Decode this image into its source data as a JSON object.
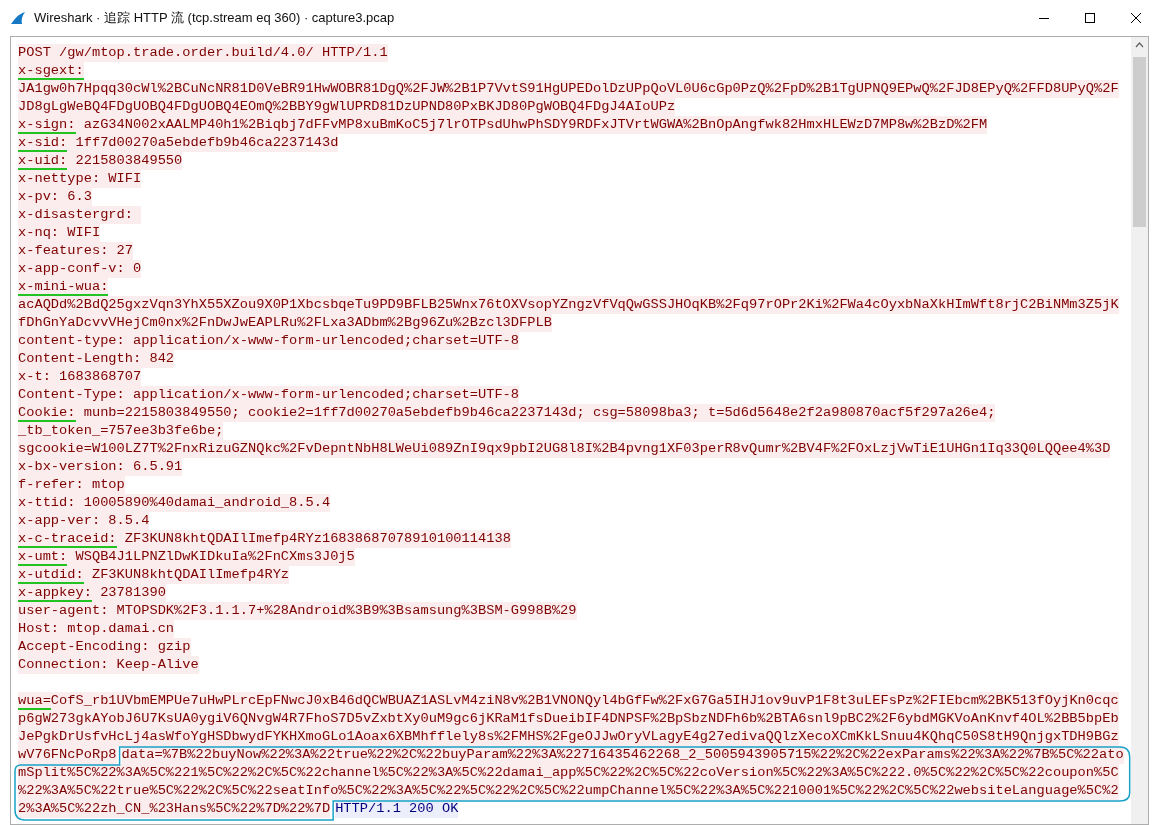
{
  "window": {
    "title": "Wireshark · 追踪 HTTP 流 (tcp.stream eq 360) · capture3.pcap"
  },
  "stream": [
    {
      "parts": [
        {
          "text": "POST /gw/mtop.trade.order.build/4.0/ HTTP/1.1",
          "kind": "request"
        }
      ]
    },
    {
      "parts": [
        {
          "text": "x-sgext:",
          "kind": "request",
          "underlined": true
        }
      ]
    },
    {
      "parts": [
        {
          "text": "JA1gw0h7Hpqq30cWl%2BCuNcNR81D0VeBR91HwWOBR81DgQ%2FJW%2B1P7VvtS91HgUPEDolDzUPpQoVL0U6cGp0PzQ%2FpD%2B1TgUPNQ9EPwQ%2FJD8EPyQ%2FFD8UPyQ%2F",
          "kind": "request"
        }
      ]
    },
    {
      "parts": [
        {
          "text": "JD8gLgWeBQ4FDgUOBQ4FDgUOBQ4EOmQ%2BBY9gWlUPRD81DzUPND80PxBKJD80PgWOBQ4FDgJ4AIoUPz",
          "kind": "request"
        }
      ]
    },
    {
      "parts": [
        {
          "text": "x-sign:",
          "kind": "request",
          "underlined": true
        },
        {
          "text": " azG34N002xAALMP40h1%2Biqbj7dFFvMP8xuBmKoC5j7lrOTPsdUhwPhSDY9RDFxJTVrtWGWA%2BnOpAngfwk82HmxHLEWzD7MP8w%2BzD%2FM",
          "kind": "request"
        }
      ]
    },
    {
      "parts": [
        {
          "text": "x-sid:",
          "kind": "request",
          "underlined": true
        },
        {
          "text": " 1ff7d00270a5ebdefb9b46ca2237143d",
          "kind": "request"
        }
      ]
    },
    {
      "parts": [
        {
          "text": "x-uid:",
          "kind": "request",
          "underlined": true
        },
        {
          "text": " 2215803849550",
          "kind": "request"
        }
      ]
    },
    {
      "parts": [
        {
          "text": "x-nettype: WIFI",
          "kind": "request"
        }
      ]
    },
    {
      "parts": [
        {
          "text": "x-pv: 6.3",
          "kind": "request"
        }
      ]
    },
    {
      "parts": [
        {
          "text": "x-disastergrd: ",
          "kind": "request"
        }
      ]
    },
    {
      "parts": [
        {
          "text": "x-nq: WIFI",
          "kind": "request"
        }
      ]
    },
    {
      "parts": [
        {
          "text": "x-features: 27",
          "kind": "request"
        }
      ]
    },
    {
      "parts": [
        {
          "text": "x-app-conf-v: 0",
          "kind": "request"
        }
      ]
    },
    {
      "parts": [
        {
          "text": "x-mini-wua:",
          "kind": "request",
          "underlined": true
        }
      ]
    },
    {
      "parts": [
        {
          "text": "acAQDd%2BdQ25gxzVqn3YhX55XZou9X0P1XbcsbqeTu9PD9BFLB25Wnx76tOXVsopYZngzVfVqQwGSSJHOqKB%2Fq97rOPr2Ki%2FWa4cOyxbNaXkHImWft8rjC2BiNMm3Z5jK",
          "kind": "request"
        }
      ]
    },
    {
      "parts": [
        {
          "text": "fDhGnYaDcvvVHejCm0nx%2FnDwJwEAPLRu%2FLxa3ADbm%2Bg96Zu%2Bzcl3DFPLB",
          "kind": "request"
        }
      ]
    },
    {
      "parts": [
        {
          "text": "content-type: application/x-www-form-urlencoded;charset=UTF-8",
          "kind": "request"
        }
      ]
    },
    {
      "parts": [
        {
          "text": "Content-Length: 842",
          "kind": "request"
        }
      ]
    },
    {
      "parts": [
        {
          "text": "x-t: 1683868707",
          "kind": "request"
        }
      ]
    },
    {
      "parts": [
        {
          "text": "Content-Type: application/x-www-form-urlencoded;charset=UTF-8",
          "kind": "request"
        }
      ]
    },
    {
      "parts": [
        {
          "text": "Cookie:",
          "kind": "request",
          "underlined": true
        },
        {
          "text": " munb=2215803849550; cookie2=1ff7d00270a5ebdefb9b46ca2237143d; csg=58098ba3; t=5d6d5648e2f2a980870acf5f297a26e4;",
          "kind": "request"
        }
      ]
    },
    {
      "parts": [
        {
          "text": "_tb_token_=757ee3b3fe6be;",
          "kind": "request"
        }
      ]
    },
    {
      "parts": [
        {
          "text": "sgcookie=W100LZ7T%2FnxRizuGZNQkc%2FvDepntNbH8LWeUi089ZnI9qx9pbI2UG8l8I%2B4pvng1XF03perR8vQumr%2BV4F%2FOxLzjVwTiE1UHGn1Iq33Q0LQQee4%3D",
          "kind": "request"
        }
      ]
    },
    {
      "parts": [
        {
          "text": "x-bx-version: 6.5.91",
          "kind": "request"
        }
      ]
    },
    {
      "parts": [
        {
          "text": "f-refer: mtop",
          "kind": "request"
        }
      ]
    },
    {
      "parts": [
        {
          "text": "x-ttid: 10005890%40damai_android_8.5.4",
          "kind": "request"
        }
      ]
    },
    {
      "parts": [
        {
          "text": "x-app-ver: 8.5.4",
          "kind": "request"
        }
      ]
    },
    {
      "parts": [
        {
          "text": "x-c-traceid:",
          "kind": "request",
          "underlined": true
        },
        {
          "text": " ZF3KUN8khtQDAIlImefp4RYz16838687078910100114138",
          "kind": "request"
        }
      ]
    },
    {
      "parts": [
        {
          "text": "x-umt:",
          "kind": "request",
          "underlined": true
        },
        {
          "text": " WSQB4J1LPNZlDwKIDkuIa%2FnCXms3J0j5",
          "kind": "request"
        }
      ]
    },
    {
      "parts": [
        {
          "text": "x-utdid:",
          "kind": "request",
          "underlined": true
        },
        {
          "text": " ZF3KUN8khtQDAIlImefp4RYz",
          "kind": "request"
        }
      ]
    },
    {
      "parts": [
        {
          "text": "x-appkey:",
          "kind": "request",
          "underlined": true
        },
        {
          "text": " 23781390",
          "kind": "request"
        }
      ]
    },
    {
      "parts": [
        {
          "text": "user-agent: MTOPSDK%2F3.1.1.7+%28Android%3B9%3Bsamsung%3BSM-G998B%29",
          "kind": "request"
        }
      ]
    },
    {
      "parts": [
        {
          "text": "Host: mtop.damai.cn",
          "kind": "request"
        }
      ]
    },
    {
      "parts": [
        {
          "text": "Accept-Encoding: gzip",
          "kind": "request"
        }
      ]
    },
    {
      "parts": [
        {
          "text": "Connection: Keep-Alive",
          "kind": "request"
        }
      ]
    },
    {
      "gap_before": true,
      "parts": [
        {
          "text": "wua=",
          "kind": "request",
          "underlined": true
        },
        {
          "text": "CofS_rb1UVbmEMPUe7uHwPLrcEpFNwcJ0xB46dQCWBUAZ1ASLvM4ziN8v%2B1VNONQyl4bGfFw%2FxG7Ga5IHJ1ov9uvP1F8t3uLEFsPz%2FIEbcm%2BK513fOyjKn0cqc",
          "kind": "request"
        }
      ]
    },
    {
      "parts": [
        {
          "text": "p6gW273gkAYobJ6U7KsUA0ygiV6QNvgW4R7FhoS7D5vZxbtXy0uM9gc6jKRaM1fsDueibIF4DNPSF%2BpSbzNDFh6b%2BTA6snl9pBC2%2F6ybdMGKVoAnKnvf4OL%2BB5bpEb",
          "kind": "request"
        }
      ]
    },
    {
      "parts": [
        {
          "text": "JePgkDrUsfvHcLj4asWfoYgHSDbwydFYKHXmoGLo1Aoax6XBMhfflely8s%2FMHS%2FgeOJJwOryVLagyE4g27edivaQQlzXecoXCmKkLSnuu4KQhqC50S8tH9QnjgxTDH9BGz",
          "kind": "request"
        }
      ]
    },
    {
      "parts": [
        {
          "text": "wV76FNcPoRp8",
          "kind": "request"
        },
        {
          "text": "data=%7B%22buyNow%22%3A%22true%22%2C%22buyParam%22%3A%22716435462268_2_5005943905715%22%2C%22exParams%22%3A%22%7B%5C%22ato",
          "kind": "request",
          "circled": true
        }
      ]
    },
    {
      "parts": [
        {
          "text": "mSplit%5C%22%3A%5C%221%5C%22%2C%5C%22channel%5C%22%3A%5C%22damai_app%5C%22%2C%5C%22coVersion%5C%22%3A%5C%222.0%5C%22%2C%5C%22coupon%5C",
          "kind": "request",
          "circled": true
        }
      ]
    },
    {
      "parts": [
        {
          "text": "%22%3A%5C%22true%5C%22%2C%5C%22seatInfo%5C%22%3A%5C%22%5C%22%2C%5C%22umpChannel%5C%22%3A%5C%2210001%5C%22%2C%5C%22websiteLanguage%5C%2",
          "kind": "request",
          "circled": true
        }
      ]
    },
    {
      "parts": [
        {
          "text": "2%3A%5C%22zh_CN_%23Hans%5C%22%7D%22%7D",
          "kind": "request",
          "circled": true
        },
        {
          "text": "HTTP/1.1 200 OK",
          "kind": "response"
        }
      ]
    }
  ]
}
